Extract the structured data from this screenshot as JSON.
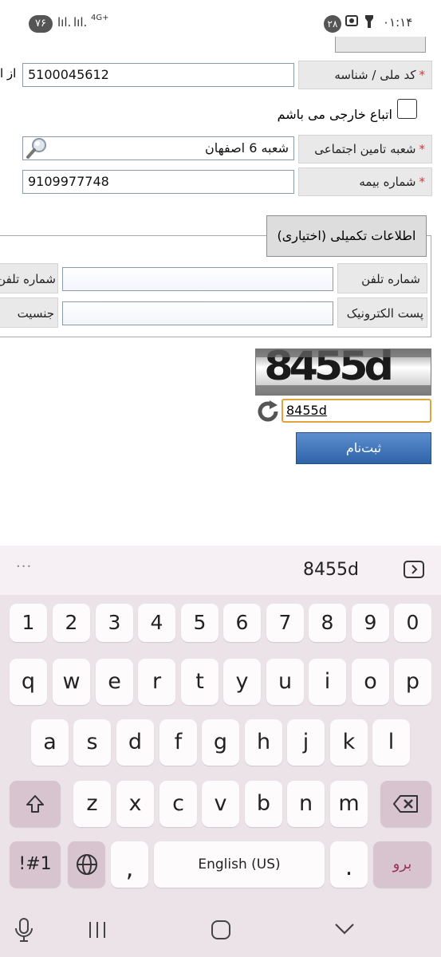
{
  "status_bar": {
    "battery": "۷۶",
    "signal_1": "lıl.",
    "signal_2": "lıl.",
    "network": "4G+",
    "notification_count": "۲۸",
    "time": "۰۱:۱۴"
  },
  "form": {
    "national_id": {
      "label": "کد ملی / شناسه",
      "value": "5100045612",
      "side_label": "از ا"
    },
    "foreign_checkbox": {
      "label": "اتباع خارجی می باشم",
      "checked": false
    },
    "branch": {
      "label": "شعبه تامین اجتماعی",
      "value": "شعبه 6 اصفهان"
    },
    "insurance_number": {
      "label": "شماره بیمه",
      "value": "9109977748"
    },
    "optional_section": {
      "title": "اطلاعات تکمیلی (اختیاری)",
      "phone_label": "شماره تلفن",
      "mobile_label": "شماره تلفن",
      "email_label": "پست الکترونیک",
      "gender_label": "جنسیت"
    },
    "captcha": {
      "image_text": "8455d",
      "input_value": "8455d"
    },
    "submit_label": "ثبت‌نام"
  },
  "keyboard": {
    "suggestion": "8455d",
    "more_label": "···",
    "number_row": [
      "1",
      "2",
      "3",
      "4",
      "5",
      "6",
      "7",
      "8",
      "9",
      "0"
    ],
    "row1": [
      "q",
      "w",
      "e",
      "r",
      "t",
      "y",
      "u",
      "i",
      "o",
      "p"
    ],
    "row2": [
      "a",
      "s",
      "d",
      "f",
      "g",
      "h",
      "j",
      "k",
      "l"
    ],
    "row3": [
      "z",
      "x",
      "c",
      "v",
      "b",
      "n",
      "m"
    ],
    "symbols_label": "!#1",
    "comma_label": ",",
    "space_label": "English (US)",
    "period_label": ".",
    "go_label": "برو"
  }
}
